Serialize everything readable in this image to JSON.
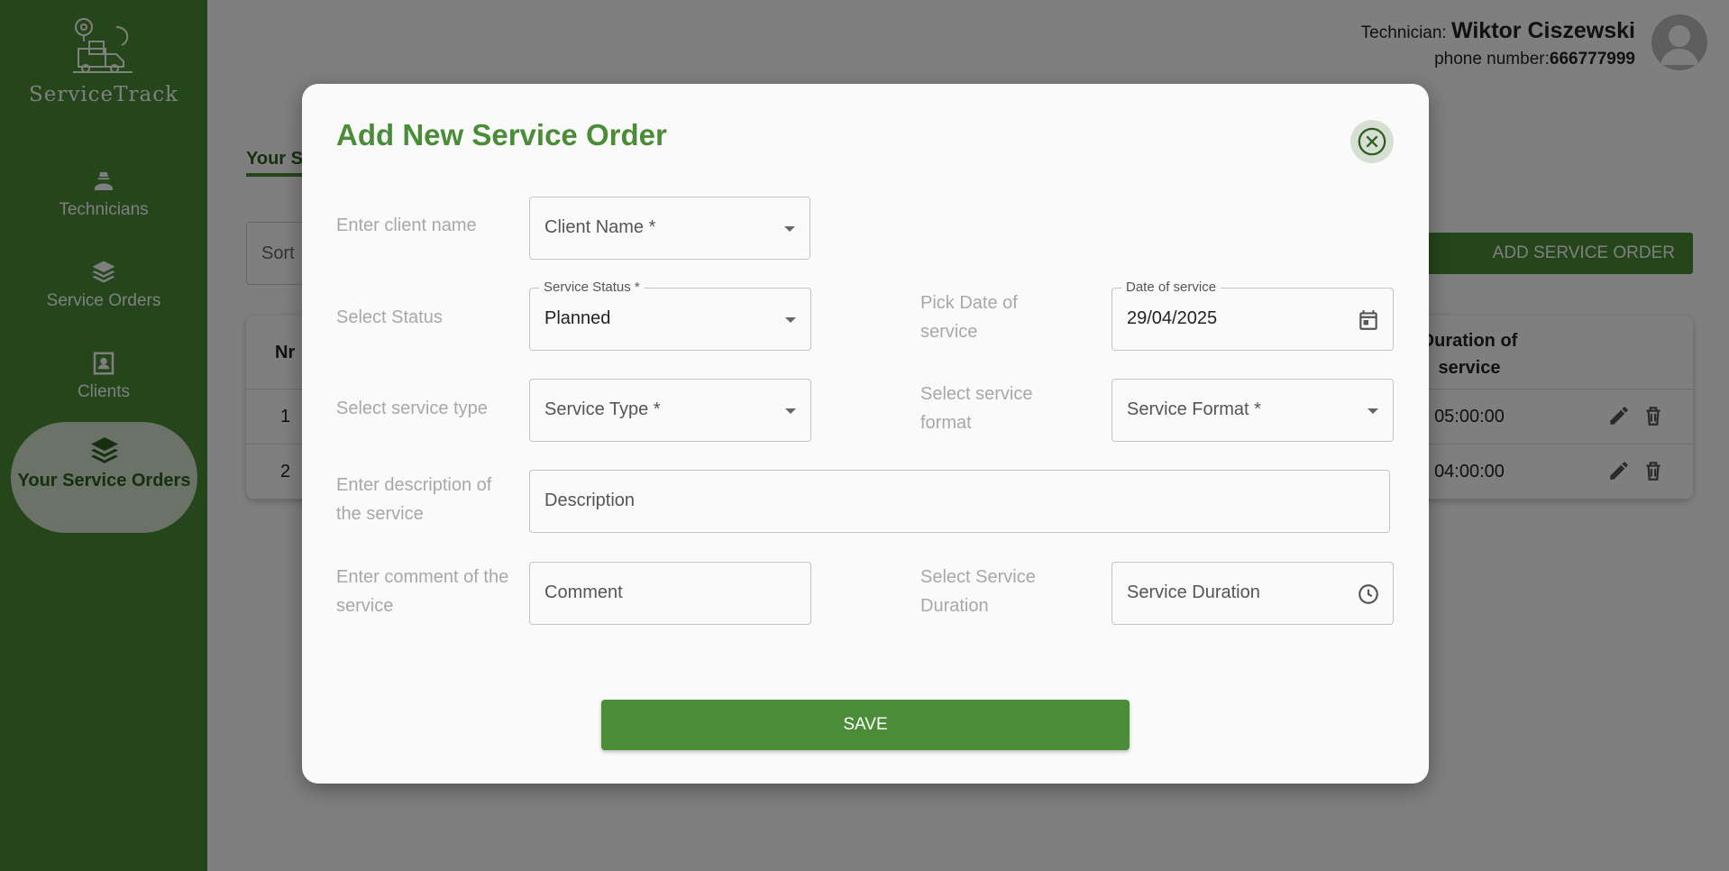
{
  "app": {
    "name": "ServiceTrack"
  },
  "sidebar": {
    "items": [
      {
        "label": "Technicians",
        "icon": "technician-icon"
      },
      {
        "label": "Service Orders",
        "icon": "layers-icon"
      },
      {
        "label": "Clients",
        "icon": "contact-card-icon"
      },
      {
        "label": "Your Service Orders",
        "icon": "layers-icon",
        "active": true
      }
    ]
  },
  "header": {
    "technician_prefix": "Technician:",
    "technician_name": "Wiktor Ciszewski",
    "phone_prefix": "phone number:",
    "phone_value": "666777999"
  },
  "page": {
    "tab_label": "Your S",
    "sort_label": "Sort",
    "add_button_label": "ADD SERVICE ORDER"
  },
  "table": {
    "col_nr": "Nr",
    "col_duration": "Duration of service",
    "rows": [
      {
        "nr": "1",
        "duration": "05:00:00"
      },
      {
        "nr": "2",
        "duration": "04:00:00"
      }
    ]
  },
  "modal": {
    "title": "Add New Service Order",
    "client": {
      "row_label": "Enter client name",
      "placeholder": "Client Name *"
    },
    "status": {
      "row_label": "Select Status",
      "field_label": "Service Status *",
      "value": "Planned"
    },
    "date": {
      "row_label": "Pick Date of service",
      "field_label": "Date of service",
      "value": "29/04/2025"
    },
    "type": {
      "row_label": "Select service type",
      "placeholder": "Service Type *"
    },
    "format": {
      "row_label": "Select service format",
      "placeholder": "Service Format *"
    },
    "description": {
      "row_label": "Enter description of the service",
      "placeholder": "Description"
    },
    "comment": {
      "row_label": "Enter comment of the service",
      "placeholder": "Comment"
    },
    "duration": {
      "row_label": "Select Service Duration",
      "placeholder": "Service Duration"
    },
    "save_label": "SAVE"
  },
  "colors": {
    "brand_green": "#4a8c37",
    "dark_green": "#2c5f1f",
    "overlay": "rgba(0,0,0,0.5)"
  }
}
